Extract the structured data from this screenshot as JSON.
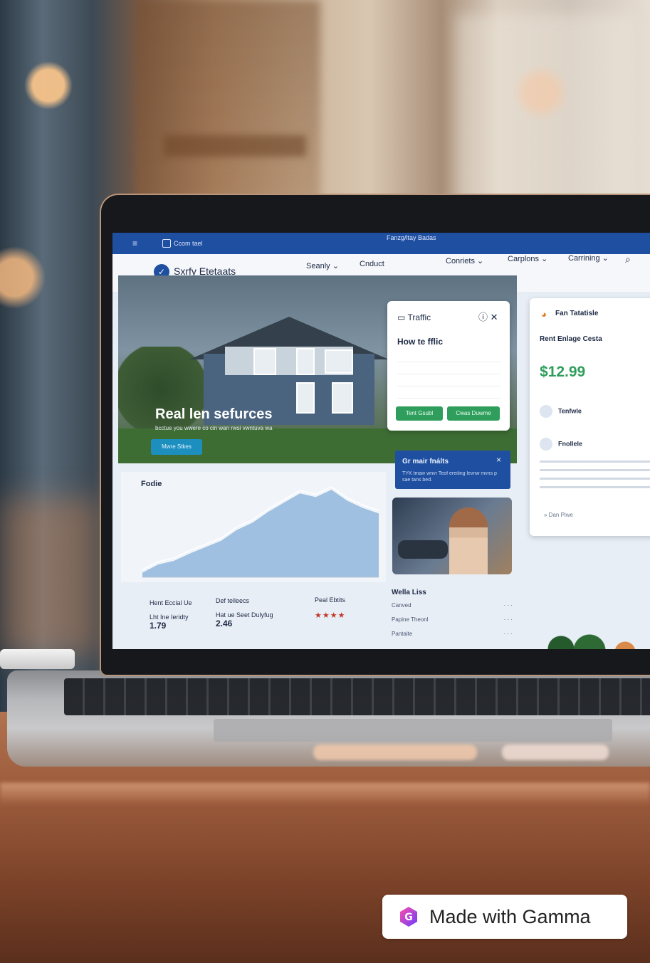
{
  "screen": {
    "topbar": {
      "menu_icon": "hamburger-icon",
      "title": "Ccom tael",
      "url": "Fanzg/ltay Badas"
    },
    "navbar": {
      "brand": "Sxrfy Etetaats",
      "items": [
        "Seanly ⌄",
        "Cnduct",
        "Conriets ⌄",
        "Carplons ⌄",
        "Carrining ⌄"
      ],
      "search_icon": "search-icon"
    },
    "hero": {
      "title": "Real len sefurces",
      "subtitle": "bcctue you wwere co cin wan rwsi vwntuva wa",
      "button": "Mwre Stkes"
    },
    "traffic_card": {
      "title": "Traffic",
      "subtitle": "How te fflic",
      "buttons": [
        "Tent Gsubl",
        "Cwas Duwme"
      ]
    },
    "side_card": {
      "title": "Fan Tatatisle",
      "subtitle": "Rent Enlage Cesta",
      "price": "$12.99",
      "items": [
        "Tenfwle",
        "Fnollele"
      ],
      "link": "»  Dan Piwe"
    },
    "chart_label": "Fodie",
    "notice": {
      "title": "Gr mair fnálts",
      "text": "TYK tmaiv wnvr Teof ereiling levnw mvns p sae tans bed.",
      "close": "×"
    },
    "stats": [
      {
        "label": "Hent Eccial Ue",
        "sub": "Lht Ine Ieridty",
        "value": "1.79"
      },
      {
        "label": "Def telleecs",
        "sub": "Hat ue Seet Dulyfug",
        "value": "2.46"
      },
      {
        "label": "Peal Ebtits",
        "stars": "★★★★"
      }
    ],
    "list": {
      "header": "Wella Liss",
      "items": [
        "Canved",
        "Papine Theonl",
        "Pantaite"
      ]
    },
    "chart_data": {
      "type": "area",
      "values": [
        5,
        14,
        18,
        26,
        33,
        40,
        52,
        60,
        72,
        82,
        92,
        88,
        96,
        84,
        76,
        70
      ],
      "ylim": [
        0,
        100
      ]
    }
  },
  "badge": {
    "text": "Made with Gamma"
  }
}
